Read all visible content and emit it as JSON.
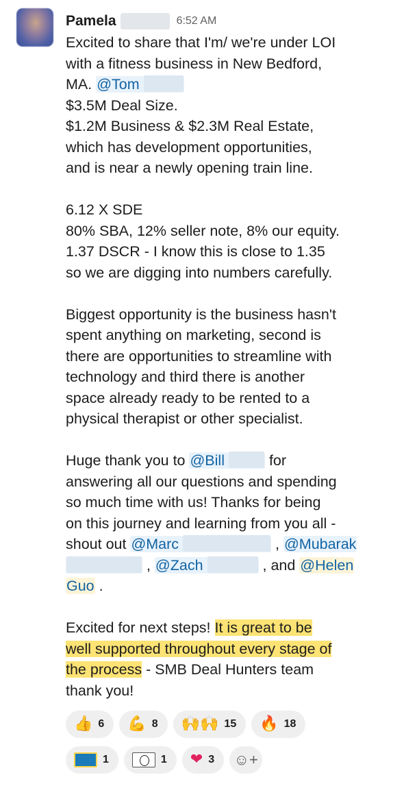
{
  "message": {
    "author": "Pamela",
    "time": "6:52 AM",
    "p1": {
      "l1": "Excited to share that I'm/ we're under LOI",
      "l2": "with a fitness business in New Bedford,",
      "l3_pre": "MA.  ",
      "l3_mention": "@Tom"
    },
    "l4": "$3.5M Deal Size.",
    "l5": "$1.2M Business & $2.3M Real Estate,",
    "l6": "which has development opportunities,",
    "l7": "and is near a newly opening train line.",
    "p2": {
      "l1": "6.12 X SDE",
      "l2": "80% SBA, 12% seller note, 8% our equity.",
      "l3": "1.37 DSCR - I know this is close to 1.35",
      "l4": "so we are digging into numbers carefully."
    },
    "p3": {
      "l1": "Biggest opportunity is the business hasn't",
      "l2": "spent anything on marketing, second is",
      "l3": "there are opportunities to streamline with",
      "l4": "technology and third there is another",
      "l5": "space already ready to be rented to a",
      "l6": "physical therapist or other specialist."
    },
    "p4": {
      "l1_pre": "Huge thank you to ",
      "l1_mention": "@Bill",
      "l1_post": " for",
      "l2": "answering all our questions and spending",
      "l3": "so much time with us!  Thanks for being",
      "l4": "on this journey and learning from you all -",
      "l5_pre": "shout out ",
      "l5_mention1": "@Marc",
      "l5_sep": " , ",
      "l5_mention2": "@Mubarak",
      "l6_sep1": " , ",
      "l6_mention": "@Zach",
      "l6_and": " , and ",
      "l6_mention2": "@Helen",
      "l7_mention": "Guo",
      "l7_post": " ."
    },
    "p5": {
      "l1_pre": "Excited for next steps!  ",
      "l1_hl": "It is great to be",
      "l2_hl": "well supported throughout every stage of",
      "l3_hl": "the process",
      "l3_post": " - SMB Deal Hunters team",
      "l4": "thank you!"
    }
  },
  "reactions": [
    {
      "icon": "thumbs-up-icon",
      "glyph": "👍",
      "count": "6"
    },
    {
      "icon": "flexed-biceps-icon",
      "glyph": "💪",
      "count": "8"
    },
    {
      "icon": "raised-hands-icon",
      "glyph": "🙌🙌",
      "count": "15"
    },
    {
      "icon": "fire-icon",
      "glyph": "🔥",
      "count": "18"
    },
    {
      "icon": "awesome-sticker-icon",
      "glyph": "",
      "count": "1"
    },
    {
      "icon": "cartoon-sticker-icon",
      "glyph": "",
      "count": "1"
    },
    {
      "icon": "red-heart-icon",
      "glyph": "❤",
      "count": "3"
    }
  ],
  "add_reaction": {
    "icon": "add-reaction-icon",
    "glyph": "☺+"
  }
}
